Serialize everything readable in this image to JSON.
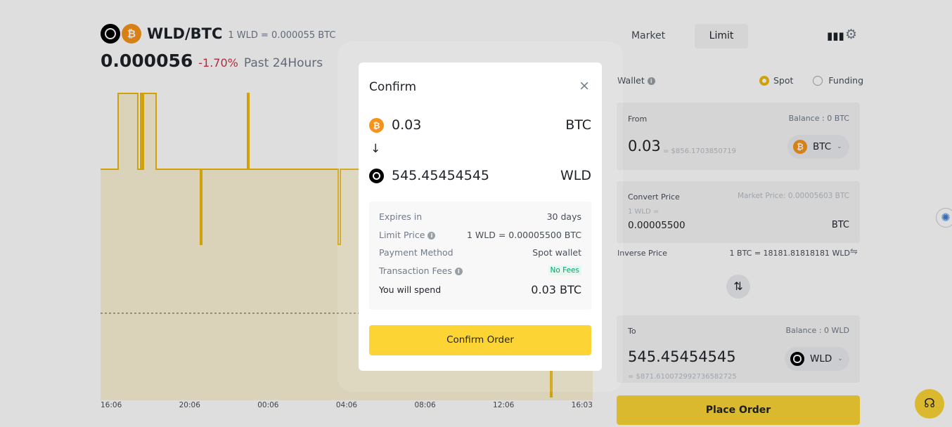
{
  "header": {
    "pair": "WLD/BTC",
    "rate": "1 WLD = 0.000055 BTC",
    "price": "0.000056",
    "change": "-1.70%",
    "period": "Past 24Hours"
  },
  "tabs": {
    "market": "Market",
    "limit": "Limit"
  },
  "chart": {
    "x_ticks": [
      "16:06",
      "20:06",
      "00:06",
      "04:06",
      "08:06",
      "12:06",
      "16:03"
    ],
    "line_color": "#f0b90b"
  },
  "wallet": {
    "label": "Wallet",
    "options": [
      "Spot",
      "Funding"
    ],
    "selected": "Spot"
  },
  "from": {
    "label": "From",
    "balance": "Balance : 0 BTC",
    "amount": "0.03",
    "usd": "= $856.1703850719",
    "coin": "BTC"
  },
  "convert": {
    "label": "Convert Price",
    "market_price": "Market Price: 0.00005603 BTC",
    "unit": "1 WLD =",
    "value": "0.00005500",
    "coin": "BTC"
  },
  "inverse": {
    "label": "Inverse Price",
    "value": "1 BTC = 18181.81818181 WLD"
  },
  "to": {
    "label": "To",
    "balance": "Balance : 0 WLD",
    "amount": "545.45454545",
    "usd": "= $871.610072992736582725",
    "coin": "WLD"
  },
  "place_order": "Place Order",
  "modal": {
    "title": "Confirm",
    "from_amount": "0.03",
    "from_coin": "BTC",
    "to_amount": "545.45454545",
    "to_coin": "WLD",
    "details": [
      {
        "label": "Expires in",
        "value": "30 days"
      },
      {
        "label": "Limit Price",
        "value": "1 WLD = 0.00005500 BTC"
      },
      {
        "label": "Payment Method",
        "value": "Spot wallet"
      },
      {
        "label": "Transaction Fees",
        "value": "No Fees"
      }
    ],
    "spend_label": "You will spend",
    "spend_value": "0.03 BTC",
    "confirm": "Confirm Order"
  },
  "colors": {
    "accent": "#fcd535",
    "negative": "#cf304a",
    "positive": "#03a66d"
  }
}
